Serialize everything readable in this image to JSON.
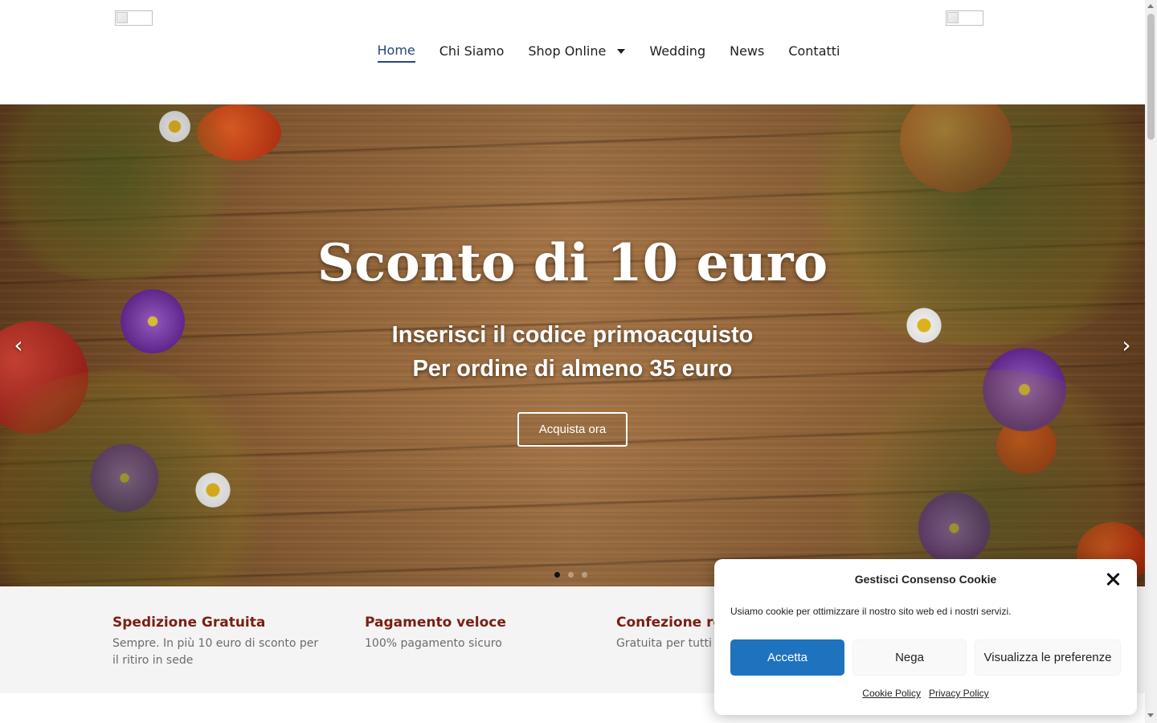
{
  "nav": {
    "items": [
      {
        "label": "Home",
        "active": true
      },
      {
        "label": "Chi Siamo"
      },
      {
        "label": "Shop Online",
        "dropdown": true
      },
      {
        "label": "Wedding"
      },
      {
        "label": "News"
      },
      {
        "label": "Contatti"
      }
    ]
  },
  "hero": {
    "title": "Sconto di 10 euro",
    "subtitle_line1": "Inserisci il codice primoacquisto",
    "subtitle_line2": "Per ordine di almeno 35 euro",
    "cta_label": "Acquista ora",
    "prev_icon": "‹",
    "next_icon": "›",
    "slides_count": 3,
    "active_slide": 1
  },
  "features": [
    {
      "title": "Spedizione Gratuita",
      "text": "Sempre. In più 10 euro di sconto per il ritiro in sede"
    },
    {
      "title": "Pagamento veloce",
      "text": "100% pagamento sicuro"
    },
    {
      "title": "Confezione re",
      "text": "Gratuita per tutti"
    }
  ],
  "cookie": {
    "title": "Gestisci Consenso Cookie",
    "text": "Usiamo cookie per ottimizzare il nostro sito web ed i nostri servizi.",
    "accept_label": "Accetta",
    "deny_label": "Nega",
    "prefs_label": "Visualizza le preferenze",
    "cookie_policy_label": "Cookie Policy",
    "privacy_policy_label": "Privacy Policy"
  },
  "colors": {
    "nav_active": "#27487a",
    "feature_title": "#7a1f12",
    "accept_button": "#1e73be"
  }
}
